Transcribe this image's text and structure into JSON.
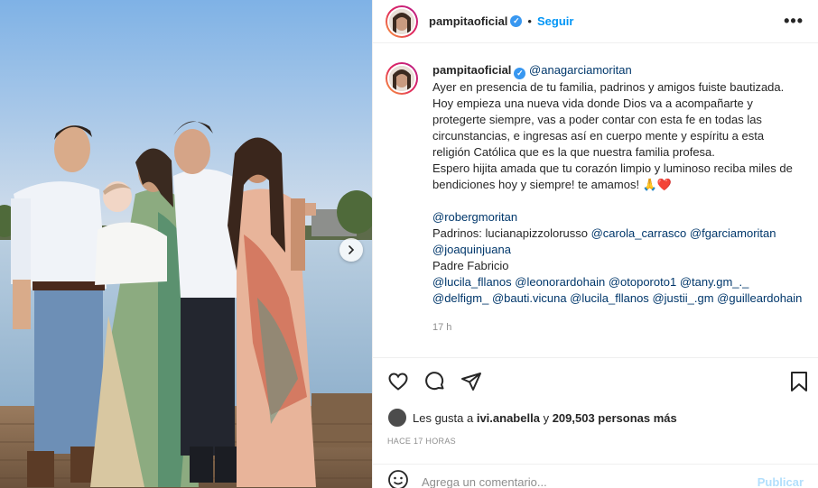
{
  "post": {
    "author": "pampitaoficial",
    "follow_label": "Seguir",
    "separator": "•",
    "more_label": "•••"
  },
  "caption": {
    "author": "pampitaoficial",
    "mention": "@anagarciamoritan",
    "paragraph1": "Ayer en presencia de tu familia, padrinos y amigos fuiste bautizada. Hoy empieza una nueva vida donde Dios va a acompañarte y protegerte siempre, vas a poder contar con esta fe en todas las circunstancias, e ingresas así en cuerpo mente y espíritu a esta religión Católica que es la que nuestra familia profesa.",
    "paragraph2": "Espero hijita amada que tu corazón limpio y luminoso reciba miles de bendiciones hoy y siempre! te amamos! 🙏❤️",
    "mention_father": "@robergmoritan",
    "padrinos_label": "Padrinos: lucianapizzolorusso",
    "padrinos_mentions": [
      "@carola_carrasco",
      "@fgarciamoritan",
      "@joaquinjuana"
    ],
    "padre_label": "Padre Fabricio",
    "tagged": [
      "@lucila_fllanos",
      "@leonorardohain",
      "@otoporoto1",
      "@tany.gm_._",
      "@delfigm_",
      "@bauti.vicuna",
      "@lucila_fllanos",
      "@justii_.gm",
      "@guilleardohain"
    ],
    "time": "17 h"
  },
  "likes": {
    "prefix": "Les gusta a",
    "user": "ivi.anabella",
    "middle": "y",
    "count": "209,503 personas más"
  },
  "posted_ago": "HACE 17 HORAS",
  "comment_box": {
    "placeholder": "Agrega un comentario...",
    "publish_label": "Publicar"
  },
  "icons": [
    "verified-badge-icon",
    "heart-icon",
    "comment-icon",
    "share-icon",
    "bookmark-icon",
    "emoji-icon",
    "chevron-right-icon",
    "more-options-icon"
  ],
  "colors": {
    "accent": "#0095f6",
    "mention": "#00376b",
    "muted": "#8e8e8e",
    "publish_disabled": "#b2dffc"
  }
}
